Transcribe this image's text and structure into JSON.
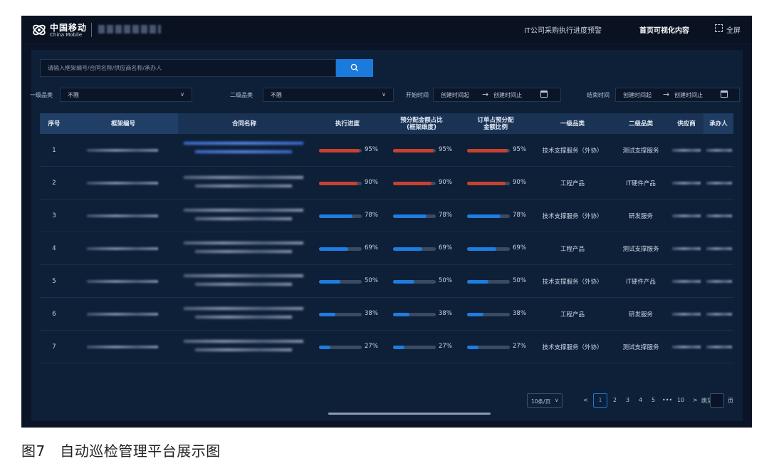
{
  "header": {
    "brand_cn": "中国移动",
    "brand_en": "China Mobile",
    "nav": [
      {
        "label": "IT公司采购执行进度预警",
        "active": false
      },
      {
        "label": "首页可视化内容",
        "active": true
      }
    ],
    "fullscreen_label": "全屏",
    "icons": [
      "china-mobile-logo-icon",
      "fullscreen-icon"
    ]
  },
  "search": {
    "placeholder": "请输入框架编号/合同名称/供应商名称/承办人",
    "button_icon": "search-icon"
  },
  "filters": {
    "category1_label": "一级品类",
    "category1_value": "不限",
    "category2_label": "二级品类",
    "category2_value": "不限",
    "start_label": "开始时间",
    "end_label": "结束时间",
    "range_from": "创建时间起",
    "range_to": "创建时间止",
    "range_arrow": "→"
  },
  "table": {
    "columns": [
      "序号",
      "框架编号",
      "合同名称",
      "执行进度",
      "预分配金额占比\n(框架维度)",
      "订单占预分配\n金额比例",
      "一级品类",
      "二级品类",
      "供应商",
      "承办人"
    ],
    "rows": [
      {
        "index": "1",
        "exec": 95,
        "exec_pct": "95%",
        "alloc": 95,
        "alloc_pct": "95%",
        "order": 95,
        "order_pct": "95%",
        "category1": "技术支撑服务（外协）",
        "category2": "测试支撑服务"
      },
      {
        "index": "2",
        "exec": 90,
        "exec_pct": "90%",
        "alloc": 90,
        "alloc_pct": "90%",
        "order": 90,
        "order_pct": "90%",
        "category1": "工程产品",
        "category2": "IT硬件产品"
      },
      {
        "index": "3",
        "exec": 78,
        "exec_pct": "78%",
        "alloc": 78,
        "alloc_pct": "78%",
        "order": 78,
        "order_pct": "78%",
        "category1": "技术支撑服务（外协）",
        "category2": "研发服务"
      },
      {
        "index": "4",
        "exec": 69,
        "exec_pct": "69%",
        "alloc": 69,
        "alloc_pct": "69%",
        "order": 69,
        "order_pct": "69%",
        "category1": "工程产品",
        "category2": "测试支撑服务"
      },
      {
        "index": "5",
        "exec": 50,
        "exec_pct": "50%",
        "alloc": 50,
        "alloc_pct": "50%",
        "order": 50,
        "order_pct": "50%",
        "category1": "技术支撑服务（外协）",
        "category2": "IT硬件产品"
      },
      {
        "index": "6",
        "exec": 38,
        "exec_pct": "38%",
        "alloc": 38,
        "alloc_pct": "38%",
        "order": 38,
        "order_pct": "38%",
        "category1": "工程产品",
        "category2": "研发服务"
      },
      {
        "index": "7",
        "exec": 27,
        "exec_pct": "27%",
        "alloc": 27,
        "alloc_pct": "27%",
        "order": 27,
        "order_pct": "27%",
        "category1": "技术支撑服务（外协）",
        "category2": "测试支撑服务"
      }
    ]
  },
  "pagination": {
    "page_size": "10条/页",
    "prev": "<",
    "pages": [
      "1",
      "2",
      "3",
      "4",
      "5"
    ],
    "ellipsis": "•••",
    "last_page": "10",
    "next": ">",
    "jump_label": "跳至",
    "jump_suffix": "页",
    "current": "1"
  },
  "colors": {
    "progress_high": "#c8412f",
    "progress_normal": "#1f7ce0",
    "accent": "#1a7bdc"
  },
  "caption": "图7　自动巡检管理平台展示图"
}
